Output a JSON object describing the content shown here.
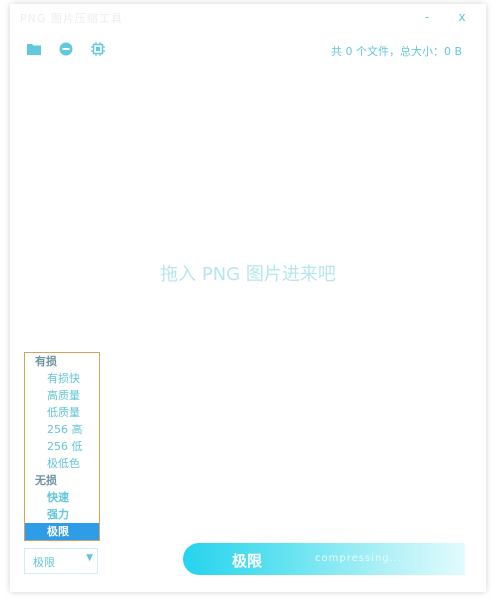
{
  "window": {
    "title": "PNG 图片压缩工具",
    "minimize_label": "-",
    "close_label": "x"
  },
  "toolbar": {
    "icons": [
      "folder-icon",
      "remove-icon",
      "cpu-icon"
    ],
    "file_summary": "共 0 个文件，总大小：0 B"
  },
  "drop_hint": "拖入 PNG 图片进来吧",
  "quality_menu": {
    "lossy_group": "有损",
    "lossy_options": [
      "有损快",
      "高质量",
      "低质量",
      "256 高",
      "256 低",
      "极低色"
    ],
    "lossless_group": "无损",
    "lossless_options": [
      "快速",
      "强力",
      "极限"
    ],
    "selected": "极限"
  },
  "select": {
    "value": "极限",
    "arrow": "▼"
  },
  "compress_button": {
    "label": "极限",
    "ghost_text": "compressing..."
  },
  "colors": {
    "accent": "#26d3ee",
    "text_primary": "#62c8dc",
    "selected_bg": "#2e9ce6",
    "menu_border": "#d4a15f"
  }
}
